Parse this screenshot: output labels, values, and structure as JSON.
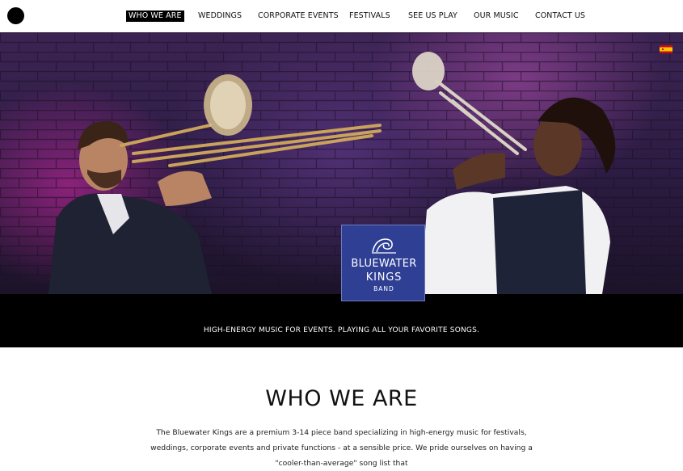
{
  "nav": {
    "items": [
      {
        "label": "WHO WE ARE",
        "active": true
      },
      {
        "label": "WEDDINGS"
      },
      {
        "label": "CORPORATE EVENTS"
      },
      {
        "label": "FESTIVALS"
      },
      {
        "label": "SEE US PLAY"
      },
      {
        "label": "OUR MUSIC"
      },
      {
        "label": "CONTACT US"
      }
    ]
  },
  "icons": {
    "menu": "menu-dot-icon",
    "language": "spain-flag-icon",
    "logo": "wave-icon"
  },
  "colors": {
    "logo_background": "#2e3f94",
    "band_background": "#000000",
    "nav_active_background": "#000000"
  },
  "logo": {
    "line1": "BLUEWATER",
    "line2": "KINGS",
    "line3": "BAND"
  },
  "tagline": "HIGH-ENERGY MUSIC FOR EVENTS. PLAYING ALL YOUR FAVORITE SONGS.",
  "section": {
    "title": "WHO WE ARE",
    "paragraph": "The Bluewater Kings are a premium 3-14 piece band specializing in high-energy music for festivals, weddings, corporate events and private functions - at a sensible price. We pride ourselves on having a \"cooler-than-average\" song list that"
  }
}
